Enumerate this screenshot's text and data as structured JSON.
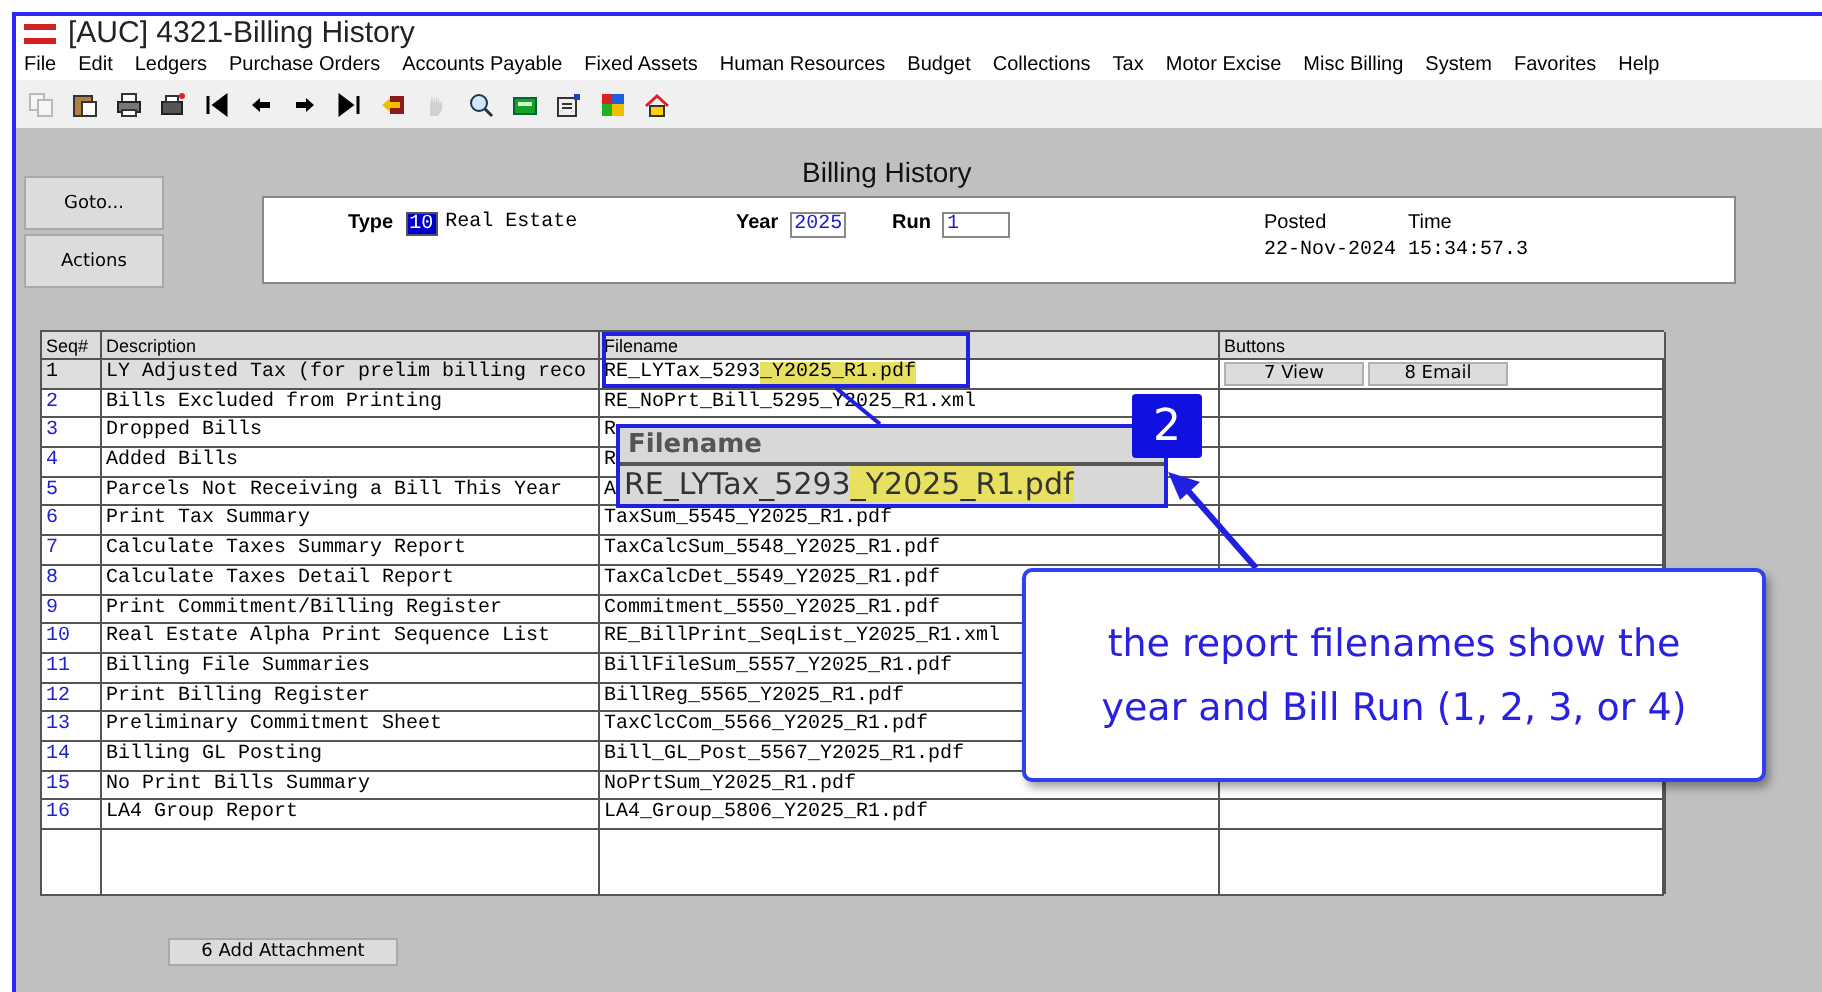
{
  "window": {
    "title": "[AUC] 4321-Billing History"
  },
  "menu": [
    "File",
    "Edit",
    "Ledgers",
    "Purchase Orders",
    "Accounts Payable",
    "Fixed Assets",
    "Human Resources",
    "Budget",
    "Collections",
    "Tax",
    "Motor Excise",
    "Misc Billing",
    "System",
    "Favorites",
    "Help"
  ],
  "toolbar": [
    {
      "kind": "copy",
      "disabled": true
    },
    {
      "kind": "paste",
      "disabled": false
    },
    {
      "kind": "print",
      "disabled": false
    },
    {
      "kind": "print-setup",
      "disabled": false
    },
    {
      "kind": "first",
      "disabled": false
    },
    {
      "kind": "prev",
      "disabled": false
    },
    {
      "kind": "next",
      "disabled": false
    },
    {
      "kind": "last",
      "disabled": false
    },
    {
      "kind": "exit",
      "disabled": false
    },
    {
      "kind": "hand",
      "disabled": true
    },
    {
      "kind": "search",
      "disabled": false
    },
    {
      "kind": "calculator",
      "disabled": false
    },
    {
      "kind": "form",
      "disabled": false
    },
    {
      "kind": "colors",
      "disabled": false
    },
    {
      "kind": "home",
      "disabled": false
    }
  ],
  "side_buttons": [
    "Goto...",
    "Actions"
  ],
  "page_title": "Billing History",
  "header": {
    "type_label": "Type",
    "type_code": "10",
    "type_name": "Real Estate",
    "year_label": "Year",
    "year": "2025",
    "run_label": "Run",
    "run": "1",
    "posted_label": "Posted",
    "posted": "22-Nov-2024",
    "time_label": "Time",
    "time": "15:34:57.3"
  },
  "table": {
    "columns": [
      "Seq#",
      "Description",
      "Filename",
      "Buttons"
    ],
    "rows": [
      {
        "seq": "1",
        "description": "LY Adjusted Tax (for prelim billing reco",
        "filename": "RE_LYTax_5293",
        "filename_highlight": "_Y2025_R1.pdf",
        "selected": true,
        "buttons": [
          "7 View",
          "8 Email"
        ]
      },
      {
        "seq": "2",
        "description": "Bills Excluded from Printing",
        "filename": "RE_NoPrt_Bill_5295_Y2025_R1.xml",
        "selected": false
      },
      {
        "seq": "3",
        "description": "Dropped Bills",
        "filename": "R",
        "selected": false
      },
      {
        "seq": "4",
        "description": "Added Bills",
        "filename": "R",
        "selected": false
      },
      {
        "seq": "5",
        "description": "Parcels Not Receiving a Bill This Year",
        "filename": "A",
        "selected": false
      },
      {
        "seq": "6",
        "description": "Print Tax Summary",
        "filename": "TaxSum_5545_Y2025_R1.pdf",
        "selected": false
      },
      {
        "seq": "7",
        "description": "Calculate Taxes Summary Report",
        "filename": "TaxCalcSum_5548_Y2025_R1.pdf",
        "selected": false
      },
      {
        "seq": "8",
        "description": "Calculate Taxes Detail Report",
        "filename": "TaxCalcDet_5549_Y2025_R1.pdf",
        "selected": false
      },
      {
        "seq": "9",
        "description": "Print Commitment/Billing Register",
        "filename": "Commitment_5550_Y2025_R1.pdf",
        "selected": false
      },
      {
        "seq": "10",
        "description": "Real Estate Alpha Print Sequence List",
        "filename": "RE_BillPrint_SeqList_Y2025_R1.xml",
        "selected": false
      },
      {
        "seq": "11",
        "description": "Billing File Summaries",
        "filename": "BillFileSum_5557_Y2025_R1.pdf",
        "selected": false
      },
      {
        "seq": "12",
        "description": "Print Billing Register",
        "filename": "BillReg_5565_Y2025_R1.pdf",
        "selected": false
      },
      {
        "seq": "13",
        "description": "Preliminary Commitment Sheet",
        "filename": "TaxClcCom_5566_Y2025_R1.pdf",
        "selected": false
      },
      {
        "seq": "14",
        "description": "Billing GL Posting",
        "filename": "Bill_GL_Post_5567_Y2025_R1.pdf",
        "selected": false
      },
      {
        "seq": "15",
        "description": "No Print Bills Summary",
        "filename": "NoPrtSum_Y2025_R1.pdf",
        "selected": false
      },
      {
        "seq": "16",
        "description": "LA4 Group Report",
        "filename": "LA4_Group_5806_Y2025_R1.pdf",
        "selected": false
      }
    ]
  },
  "footer_button": "6 Add Attachment",
  "annotation": {
    "zoom_header": "Filename",
    "zoom_filename": "RE_LYTax_5293",
    "zoom_highlight": "_Y2025_R1.pdf",
    "badge": "2",
    "note": "the report filenames show the year and Bill Run (1, 2, 3, or 4)"
  }
}
